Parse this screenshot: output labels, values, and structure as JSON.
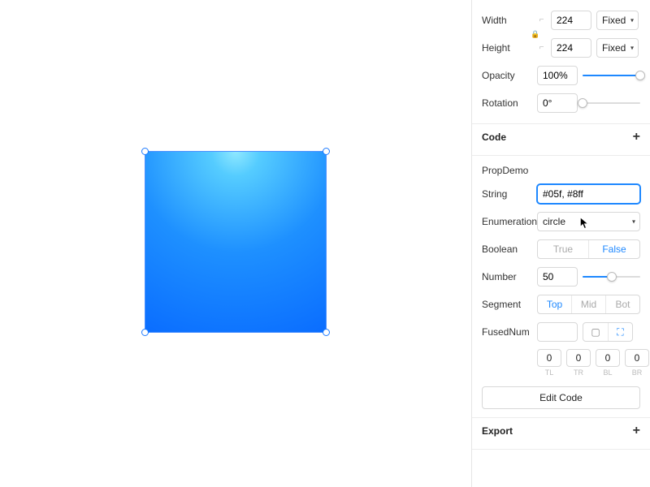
{
  "dimensions": {
    "width_label": "Width",
    "height_label": "Height",
    "width_value": "224",
    "height_value": "224",
    "width_sizing": "Fixed",
    "height_sizing": "Fixed"
  },
  "opacity": {
    "label": "Opacity",
    "value": "100%",
    "percent": 100
  },
  "rotation": {
    "label": "Rotation",
    "value": "0°",
    "percent": 0
  },
  "code_section": {
    "title": "Code"
  },
  "component": {
    "name": "PropDemo"
  },
  "props": {
    "string": {
      "label": "String",
      "value": "#05f, #8ff"
    },
    "enum": {
      "label": "Enumeration",
      "value": "circle"
    },
    "boolean": {
      "label": "Boolean",
      "true": "True",
      "false": "False",
      "active": "false"
    },
    "number": {
      "label": "Number",
      "value": "50",
      "percent": 50
    },
    "segment": {
      "label": "Segment",
      "options": [
        "Top",
        "Mid",
        "Bot"
      ],
      "active": "Top"
    },
    "fused": {
      "label": "FusedNum",
      "value": ""
    },
    "corners": {
      "tl": {
        "value": "0",
        "caption": "TL"
      },
      "tr": {
        "value": "0",
        "caption": "TR"
      },
      "bl": {
        "value": "0",
        "caption": "BL"
      },
      "br": {
        "value": "0",
        "caption": "BR"
      }
    }
  },
  "edit_code_label": "Edit Code",
  "export_section": {
    "title": "Export"
  }
}
